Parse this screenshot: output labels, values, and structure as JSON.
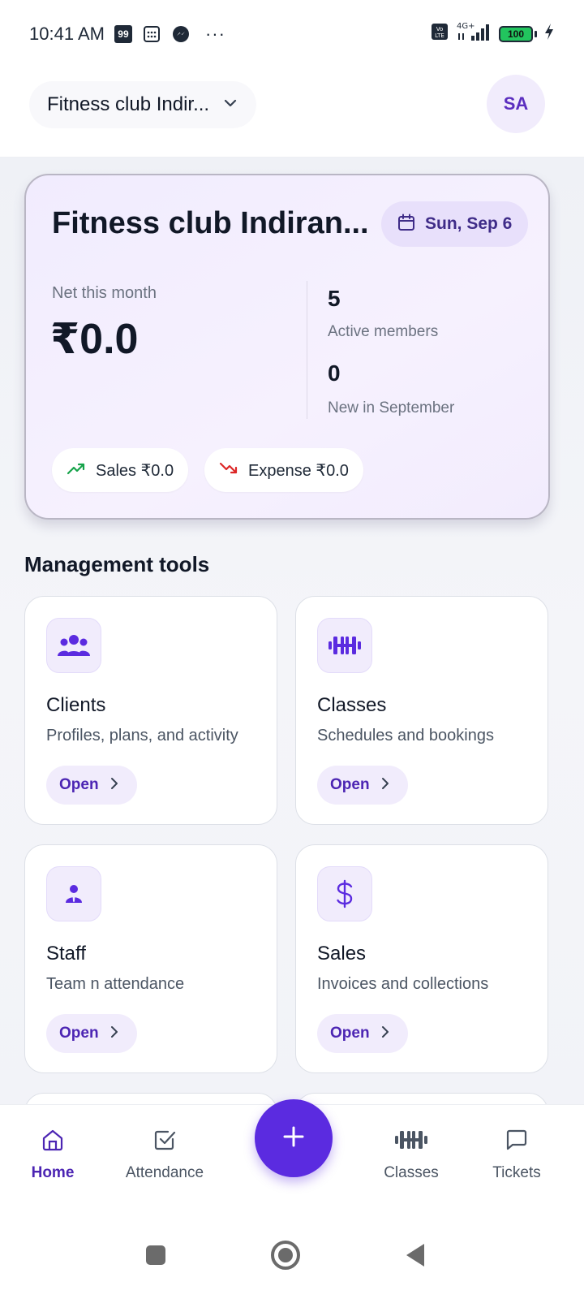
{
  "status_bar": {
    "time": "10:41 AM",
    "badge": "99",
    "more": "···",
    "network": "4G+",
    "volte": "Vo LTE",
    "battery": "100",
    "icons": [
      "calculator-icon",
      "messenger-icon",
      "signal-icon",
      "charging-icon"
    ]
  },
  "app_bar": {
    "club_name": "Fitness club Indir...",
    "avatar_initials": "SA"
  },
  "summary": {
    "title": "Fitness club Indiran...",
    "date": "Sun, Sep 6",
    "net_label": "Net this month",
    "net_value": "₹0.0",
    "active_members_value": "5",
    "active_members_label": "Active members",
    "new_members_value": "0",
    "new_members_label": "New in September",
    "sales_label": "Sales ₹0.0",
    "expense_label": "Expense ₹0.0"
  },
  "colors": {
    "accent": "#5b2be0",
    "accent_dark": "#4c25b3",
    "sales_green": "#16a34a",
    "expense_red": "#dc2626"
  },
  "tools": {
    "section_title": "Management tools",
    "items": [
      {
        "title": "Clients",
        "description": "Profiles, plans, and activity",
        "open": "Open",
        "icon": "users-icon"
      },
      {
        "title": "Classes",
        "description": "Schedules and bookings",
        "open": "Open",
        "icon": "dumbbell-icon"
      },
      {
        "title": "Staff",
        "description": "Team n attendance",
        "open": "Open",
        "icon": "staff-icon"
      },
      {
        "title": "Sales",
        "description": "Invoices and collections",
        "open": "Open",
        "icon": "dollar-icon"
      }
    ]
  },
  "bottom_nav": {
    "items": [
      {
        "label": "Home",
        "icon": "home-icon",
        "active": true
      },
      {
        "label": "Attendance",
        "icon": "check-square-icon",
        "active": false
      },
      {
        "label": "Classes",
        "icon": "dumbbell-icon",
        "active": false
      },
      {
        "label": "Tickets",
        "icon": "chat-bubble-icon",
        "active": false
      }
    ],
    "fab_icon": "plus-icon"
  }
}
